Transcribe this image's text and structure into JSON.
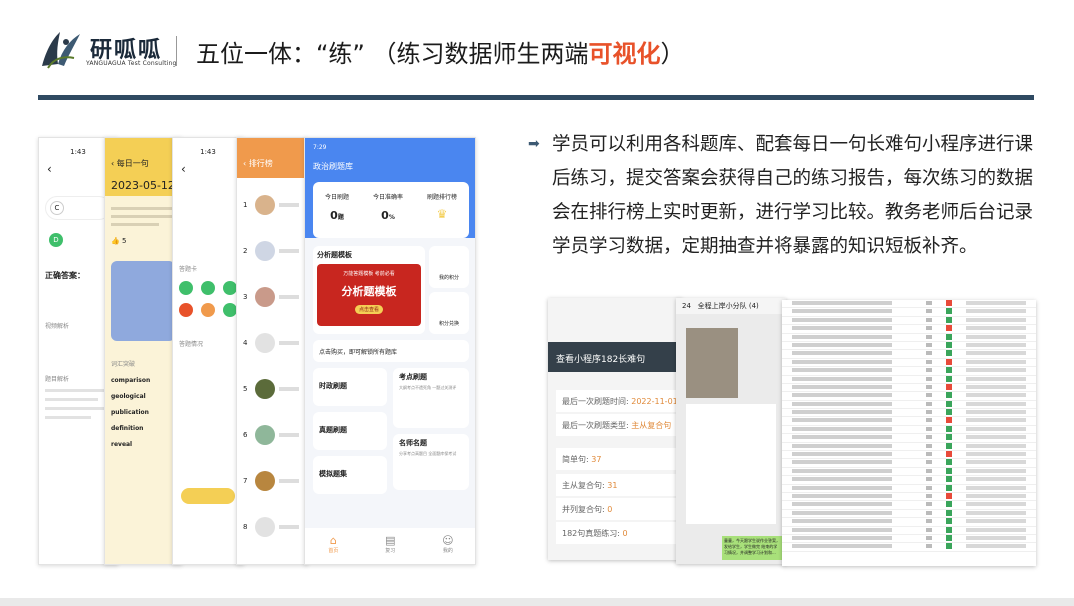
{
  "brand": {
    "name": "研呱呱",
    "subtitle": "YANGUAGUA Test Consulting"
  },
  "title": {
    "main": "五位一体：“练” （练习数据师生两端",
    "highlight": "可视化",
    "tail": "）"
  },
  "description": "学员可以利用各科题库、配套每日一句长难句小程序进行课后练习，提交答案会获得自己的练习报告，每次练习的数据会在排行榜上实时更新，进行学习比较。教务老师后台记录学员学习数据，定期抽查并将暴露的知识短板补齐。",
  "phones": {
    "p1": {
      "time": "1:43",
      "answer_label": "正确答案：",
      "video_label": "视频解析",
      "analysis_label": "题目解析"
    },
    "p2": {
      "title": "每日一句",
      "date": "2023-05-12",
      "likes": "5",
      "word1": "comparison",
      "word2": "geological",
      "word3": "publication",
      "word4": "definition",
      "word5": "reveal",
      "vocab_label": "词汇突破"
    },
    "p3": {
      "time": "1:43",
      "card_label": "答题卡",
      "status_label": "答题情况"
    },
    "p4": {
      "title": "排行榜",
      "ranks": [
        "1",
        "2",
        "3",
        "4",
        "5",
        "6",
        "7",
        "8"
      ]
    },
    "p5": {
      "time": "7:29",
      "title": "政治刷题库",
      "stats": [
        {
          "label": "今日刷题",
          "value": "0",
          "unit": "题"
        },
        {
          "label": "今日准确率",
          "value": "0",
          "unit": "%"
        },
        {
          "label": "刷题排行榜",
          "value": "",
          "unit": ""
        }
      ],
      "section_label": "分析题模板",
      "banner_small": "万能答题模板 考前必看",
      "banner_big": "分析题模板",
      "banner_btn": "点击查看",
      "side1": "我的积分",
      "side2": "积分兑换",
      "unlock_text": "点击购买，即可解锁所有题库",
      "cards": [
        "时政刷题",
        "考点刷题",
        "真题刷题",
        "名师名题",
        "模拟题集"
      ],
      "card_desc1": "大纲考点不遗死角 一题过关测评",
      "card_desc2": "分享考点高题目 全面题库保考试",
      "tabs": [
        "首页",
        "复习",
        "我的"
      ]
    }
  },
  "screens": {
    "s1": {
      "header": "查看小程序182长难句",
      "rows": [
        {
          "label": "最后一次刷题时间:",
          "value": "2022-11-01"
        },
        {
          "label": "最后一次刷题类型:",
          "value": "主从复合句"
        },
        {
          "label": "简单句:",
          "value": "37"
        },
        {
          "label": "主从复合句:",
          "value": "31"
        },
        {
          "label": "并列复合句:",
          "value": "0"
        },
        {
          "label": "182句真题练习:",
          "value": "0"
        }
      ]
    },
    "s2": {
      "count": "24",
      "header": "全程上岸小分队 (4)",
      "message": "童童，今天跟学生说作业答案，发给学生，学生做完 结束的学习情况，并调整学习计划和..."
    }
  },
  "colors": {
    "accent": "#e8522a",
    "navy": "#3d5a73",
    "blue": "#4a86f0",
    "orange": "#f09a4c",
    "yellow": "#f4cf55"
  }
}
